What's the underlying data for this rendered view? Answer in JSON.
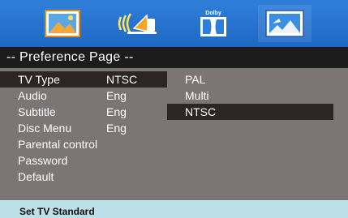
{
  "tabs": {
    "general_icon": "general-setup-icon",
    "audio_icon": "audio-setup-icon",
    "dolby_icon": "dolby-digital-icon",
    "dolby_label": "Dolby",
    "video_icon": "video-setup-icon"
  },
  "header": {
    "title": "-- Preference Page --"
  },
  "menu": {
    "items": [
      {
        "label": "TV Type",
        "value": "NTSC"
      },
      {
        "label": "Audio",
        "value": "Eng"
      },
      {
        "label": "Subtitle",
        "value": "Eng"
      },
      {
        "label": "Disc Menu",
        "value": "Eng"
      },
      {
        "label": "Parental control",
        "value": ""
      },
      {
        "label": "Password",
        "value": ""
      },
      {
        "label": "Default",
        "value": ""
      }
    ],
    "options": [
      "PAL",
      "Multi",
      "NTSC"
    ],
    "highlighted_option": "NTSC"
  },
  "status": {
    "text": "Set TV Standard"
  },
  "colors": {
    "top_bar": "#2f7fd9",
    "header_bg": "#1c1c1c",
    "menu_bg": "#7b7576",
    "selected_bg": "#2b2526",
    "status_bg": "#bddfe8"
  }
}
